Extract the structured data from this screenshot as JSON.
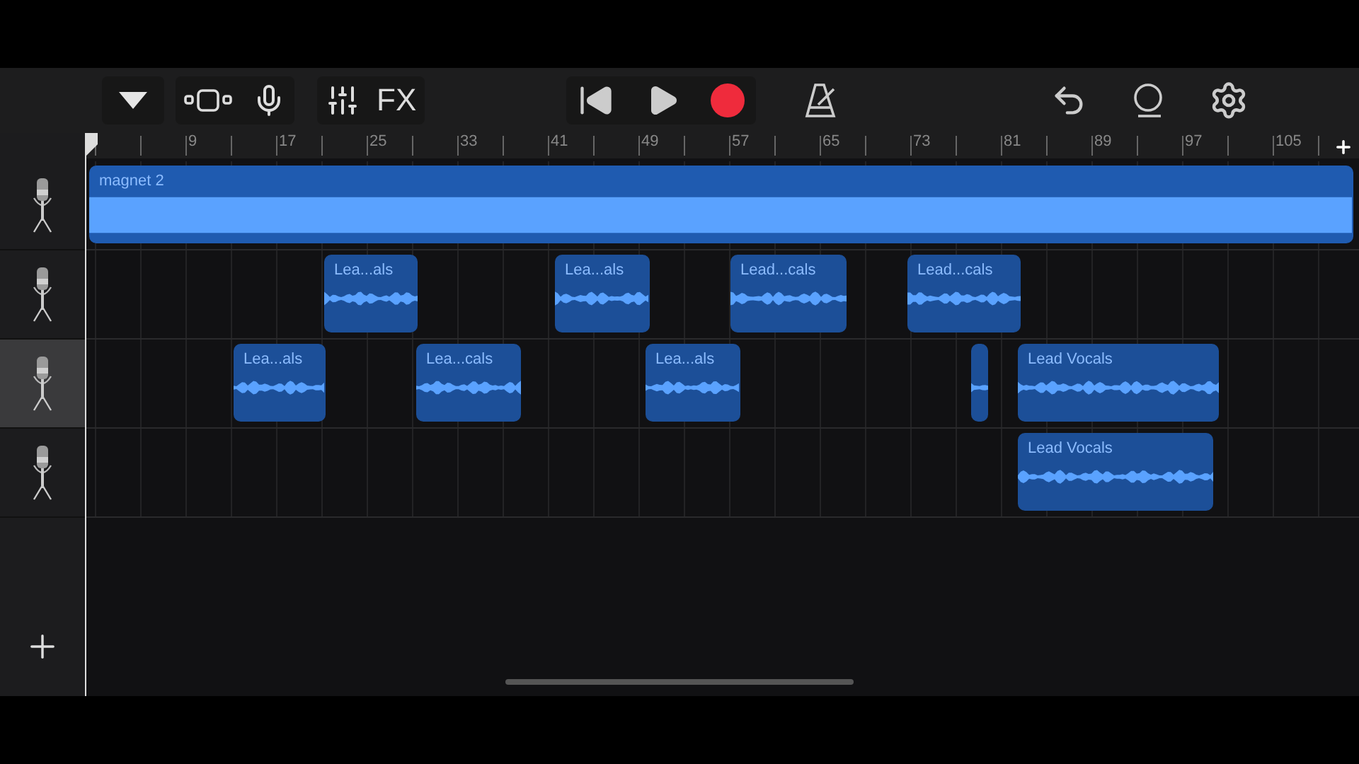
{
  "toolbar": {
    "fx_label": "FX",
    "recording": false
  },
  "ruler": {
    "labels": [
      "9",
      "17",
      "25",
      "33",
      "41",
      "49",
      "57",
      "65",
      "73",
      "81",
      "89",
      "97",
      "105"
    ]
  },
  "tracks": [
    {
      "selected": false,
      "regions": [
        {
          "kind": "labeled",
          "label": "magnet 2"
        }
      ]
    },
    {
      "selected": false,
      "regions": [
        {
          "kind": "labeled",
          "label": "Lea...als"
        },
        {
          "kind": "labeled",
          "label": "Lea...als"
        },
        {
          "kind": "labeled",
          "label": "Lead...cals"
        },
        {
          "kind": "labeled",
          "label": "Lead...cals"
        }
      ]
    },
    {
      "selected": true,
      "regions": [
        {
          "kind": "labeled",
          "label": "Lea...als"
        },
        {
          "kind": "labeled",
          "label": "Lea...cals"
        },
        {
          "kind": "labeled",
          "label": "Lea...als"
        },
        {
          "kind": "sliver"
        },
        {
          "kind": "labeled",
          "label": "Lead Vocals"
        }
      ]
    },
    {
      "selected": false,
      "regions": [
        {
          "kind": "labeled",
          "label": "Lead Vocals"
        }
      ]
    }
  ]
}
